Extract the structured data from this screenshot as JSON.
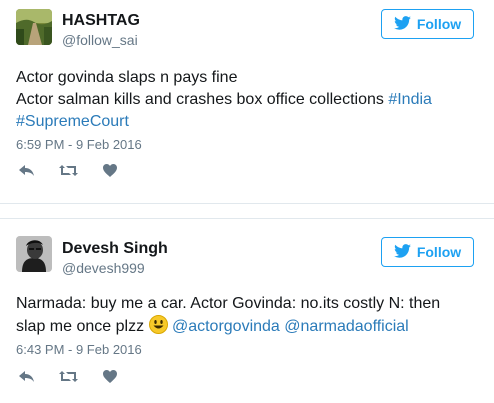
{
  "tweets": [
    {
      "display_name": "HASHTAG",
      "handle": "@follow_sai",
      "follow_label": "Follow",
      "line1": "Actor govinda slaps n pays fine",
      "line2_text": "Actor salman kills and crashes box office collections ",
      "line2_link": "#India",
      "line3_link": "#SupremeCourt",
      "timestamp": "6:59 PM - 9 Feb 2016"
    },
    {
      "display_name": "Devesh Singh",
      "handle": "@devesh999",
      "follow_label": "Follow",
      "line1": "Narmada: buy me a car. Actor Govinda: no.its costly N: then",
      "line2_text": "slap me once plzz ",
      "mention1": "@actorgovinda",
      "mention2": "@narmadaofficial",
      "timestamp": "6:43 PM - 9 Feb 2016"
    }
  ],
  "colors": {
    "accent": "#1da1f2",
    "link": "#2b7bb9",
    "muted": "#657786",
    "text": "#14171a",
    "divider": "#e1e8ed"
  },
  "icons": [
    "twitter-bird-icon",
    "reply-icon",
    "retweet-icon",
    "like-heart-icon",
    "smiley-emoji-icon"
  ]
}
